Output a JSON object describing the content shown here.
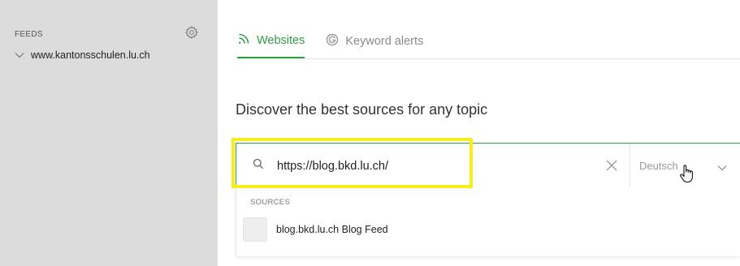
{
  "colors": {
    "accent": "#2f9e44",
    "sidebar_bg": "#dcdcdc",
    "highlight": "#f6ee1a"
  },
  "sidebar": {
    "header": "FEEDS",
    "settings_icon": "gear-icon",
    "feeds": [
      {
        "label": "www.kantonsschulen.lu.ch",
        "icon": "chevron-down-icon"
      }
    ]
  },
  "tabs": [
    {
      "label": "Websites",
      "icon": "rss-icon",
      "active": true
    },
    {
      "label": "Keyword alerts",
      "icon": "google-icon",
      "active": false
    }
  ],
  "main": {
    "heading": "Discover the best sources for any topic"
  },
  "search": {
    "value": "https://blog.bkd.lu.ch/",
    "icon": "search-icon",
    "clear_icon": "close-icon"
  },
  "language": {
    "selected": "Deutsch",
    "icon": "chevron-down-icon"
  },
  "results": {
    "section_label": "SOURCES",
    "items": [
      {
        "label": "blog.bkd.lu.ch Blog Feed"
      }
    ]
  }
}
